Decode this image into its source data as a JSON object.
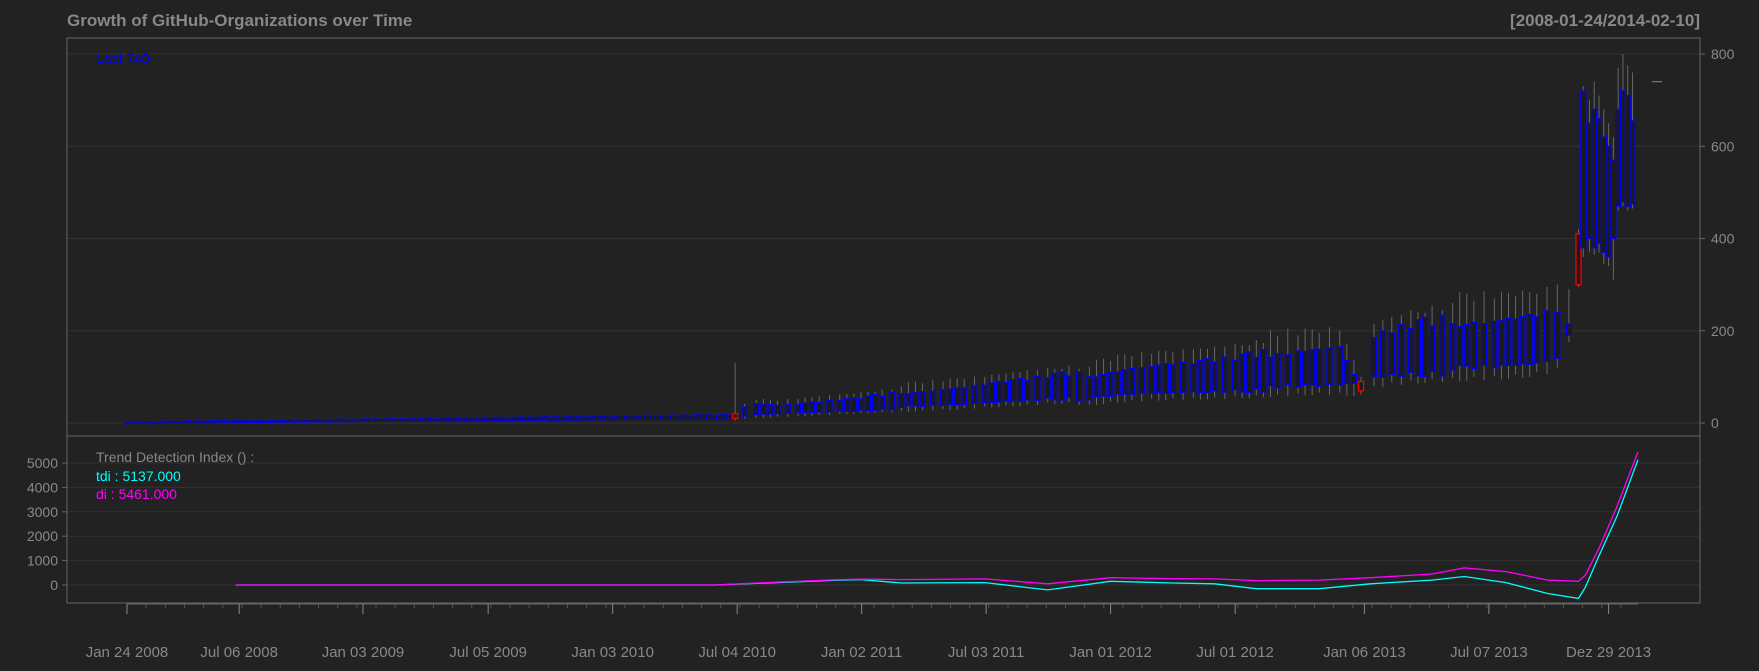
{
  "chart_data": {
    "type": "candlestick",
    "title": "Growth of GitHub-Organizations over Time",
    "date_range": "[2008-01-24/2014-02-10]",
    "last_label": "Last 740",
    "price_panel": {
      "yticks": [
        "800",
        "600",
        "400",
        "200",
        "0"
      ],
      "ylim": [
        0,
        800
      ],
      "grid": true,
      "candles": [
        {
          "x": "2010-07-01",
          "open": 10,
          "close": 20,
          "low": 5,
          "high": 130,
          "up": false
        },
        {
          "x": "2010-07-15",
          "open": 15,
          "close": 35,
          "low": 10,
          "high": 42,
          "up": true
        },
        {
          "x": "2010-08-01",
          "open": 18,
          "close": 42,
          "low": 12,
          "high": 50,
          "up": true
        },
        {
          "x": "2010-09-01",
          "open": 20,
          "close": 38,
          "low": 14,
          "high": 48,
          "up": true
        },
        {
          "x": "2010-10-01",
          "open": 22,
          "close": 40,
          "low": 15,
          "high": 52,
          "up": true
        },
        {
          "x": "2010-11-01",
          "open": 24,
          "close": 45,
          "low": 18,
          "high": 58,
          "up": true
        },
        {
          "x": "2010-12-01",
          "open": 26,
          "close": 48,
          "low": 20,
          "high": 62,
          "up": true
        },
        {
          "x": "2011-01-01",
          "open": 28,
          "close": 52,
          "low": 22,
          "high": 68,
          "up": true
        },
        {
          "x": "2011-02-01",
          "open": 30,
          "close": 58,
          "low": 24,
          "high": 72,
          "up": true
        },
        {
          "x": "2011-03-01",
          "open": 34,
          "close": 64,
          "low": 26,
          "high": 80,
          "up": true
        },
        {
          "x": "2011-04-01",
          "open": 36,
          "close": 68,
          "low": 28,
          "high": 86,
          "up": true
        },
        {
          "x": "2011-05-01",
          "open": 38,
          "close": 72,
          "low": 30,
          "high": 90,
          "up": true
        },
        {
          "x": "2011-06-01",
          "open": 40,
          "close": 76,
          "low": 32,
          "high": 95,
          "up": true
        },
        {
          "x": "2011-07-01",
          "open": 44,
          "close": 82,
          "low": 36,
          "high": 100,
          "up": true
        },
        {
          "x": "2011-08-01",
          "open": 48,
          "close": 88,
          "low": 38,
          "high": 108,
          "up": true
        },
        {
          "x": "2011-09-01",
          "open": 50,
          "close": 92,
          "low": 40,
          "high": 115,
          "up": true
        },
        {
          "x": "2011-10-01",
          "open": 54,
          "close": 98,
          "low": 44,
          "high": 120,
          "up": true
        },
        {
          "x": "2011-11-01",
          "open": 56,
          "close": 102,
          "low": 46,
          "high": 125,
          "up": true
        },
        {
          "x": "2011-12-01",
          "open": 50,
          "close": 100,
          "low": 40,
          "high": 122,
          "up": true
        },
        {
          "x": "2012-01-01",
          "open": 58,
          "close": 110,
          "low": 46,
          "high": 135,
          "up": true
        },
        {
          "x": "2012-02-01",
          "open": 62,
          "close": 118,
          "low": 50,
          "high": 145,
          "up": true
        },
        {
          "x": "2012-03-01",
          "open": 64,
          "close": 122,
          "low": 52,
          "high": 150,
          "up": true
        },
        {
          "x": "2012-04-01",
          "open": 66,
          "close": 126,
          "low": 54,
          "high": 155,
          "up": true
        },
        {
          "x": "2012-05-01",
          "open": 68,
          "close": 128,
          "low": 55,
          "high": 160,
          "up": true
        },
        {
          "x": "2012-06-01",
          "open": 70,
          "close": 132,
          "low": 56,
          "high": 165,
          "up": true
        },
        {
          "x": "2012-07-01",
          "open": 72,
          "close": 136,
          "low": 58,
          "high": 172,
          "up": true
        },
        {
          "x": "2012-08-01",
          "open": 74,
          "close": 142,
          "low": 60,
          "high": 180,
          "up": true
        },
        {
          "x": "2012-09-01",
          "open": 76,
          "close": 150,
          "low": 62,
          "high": 188,
          "up": true
        },
        {
          "x": "2012-10-01",
          "open": 78,
          "close": 156,
          "low": 64,
          "high": 190,
          "up": true
        },
        {
          "x": "2012-11-01",
          "open": 80,
          "close": 160,
          "low": 66,
          "high": 195,
          "up": true
        },
        {
          "x": "2012-12-01",
          "open": 82,
          "close": 165,
          "low": 66,
          "high": 200,
          "up": true
        },
        {
          "x": "2013-01-01",
          "open": 90,
          "close": 70,
          "low": 62,
          "high": 100,
          "up": false
        },
        {
          "x": "2013-01-20",
          "open": 100,
          "close": 185,
          "low": 80,
          "high": 215,
          "up": true
        },
        {
          "x": "2013-02-15",
          "open": 105,
          "close": 195,
          "low": 88,
          "high": 230,
          "up": true
        },
        {
          "x": "2013-03-15",
          "open": 110,
          "close": 205,
          "low": 92,
          "high": 245,
          "up": true
        },
        {
          "x": "2013-04-15",
          "open": 112,
          "close": 210,
          "low": 95,
          "high": 255,
          "up": true
        },
        {
          "x": "2013-05-15",
          "open": 115,
          "close": 215,
          "low": 98,
          "high": 260,
          "up": true
        },
        {
          "x": "2013-06-15",
          "open": 118,
          "close": 218,
          "low": 100,
          "high": 265,
          "up": true
        },
        {
          "x": "2013-07-15",
          "open": 120,
          "close": 220,
          "low": 102,
          "high": 270,
          "up": true
        },
        {
          "x": "2013-08-15",
          "open": 125,
          "close": 225,
          "low": 105,
          "high": 275,
          "up": true
        },
        {
          "x": "2013-09-15",
          "open": 130,
          "close": 230,
          "low": 110,
          "high": 280,
          "up": true
        },
        {
          "x": "2013-10-15",
          "open": 140,
          "close": 240,
          "low": 120,
          "high": 300,
          "up": true
        },
        {
          "x": "2013-11-01",
          "open": 190,
          "close": 215,
          "low": 175,
          "high": 290,
          "up": true
        },
        {
          "x": "2013-11-15",
          "open": 410,
          "close": 300,
          "low": 295,
          "high": 420,
          "up": false
        },
        {
          "x": "2013-11-22",
          "open": 380,
          "close": 720,
          "low": 360,
          "high": 730,
          "up": true
        },
        {
          "x": "2013-12-01",
          "open": 400,
          "close": 650,
          "low": 370,
          "high": 700,
          "up": true
        },
        {
          "x": "2013-12-08",
          "open": 380,
          "close": 680,
          "low": 365,
          "high": 740,
          "up": true
        },
        {
          "x": "2013-12-15",
          "open": 390,
          "close": 660,
          "low": 370,
          "high": 710,
          "up": true
        },
        {
          "x": "2013-12-22",
          "open": 370,
          "close": 620,
          "low": 345,
          "high": 680,
          "up": true
        },
        {
          "x": "2013-12-29",
          "open": 360,
          "close": 600,
          "low": 340,
          "high": 650,
          "up": true
        },
        {
          "x": "2014-01-05",
          "open": 400,
          "close": 570,
          "low": 310,
          "high": 620,
          "up": true
        },
        {
          "x": "2014-01-12",
          "open": 470,
          "close": 680,
          "low": 460,
          "high": 770,
          "up": true
        },
        {
          "x": "2014-01-19",
          "open": 480,
          "close": 720,
          "low": 470,
          "high": 800,
          "up": true
        },
        {
          "x": "2014-01-26",
          "open": 470,
          "close": 710,
          "low": 460,
          "high": 775,
          "up": true
        },
        {
          "x": "2014-02-02",
          "open": 475,
          "close": 655,
          "low": 465,
          "high": 760,
          "up": true
        }
      ],
      "early_start": "2008-01-24",
      "early_end": "2010-06-30",
      "last_value": 740
    },
    "tdi_panel": {
      "label": "Trend Detection Index () :",
      "yticks": [
        "5000",
        "4000",
        "3000",
        "2000",
        "1000",
        "0"
      ],
      "ylim": [
        -700,
        5500
      ],
      "series": [
        {
          "name": "tdi",
          "value_label": "tdi : 5137.000",
          "color": "#00ffff",
          "points": [
            [
              "2008-07-01",
              0
            ],
            [
              "2009-07-01",
              0
            ],
            [
              "2010-01-01",
              0
            ],
            [
              "2010-06-01",
              0
            ],
            [
              "2010-09-01",
              100
            ],
            [
              "2010-12-01",
              200
            ],
            [
              "2011-01-01",
              220
            ],
            [
              "2011-03-01",
              80
            ],
            [
              "2011-07-01",
              100
            ],
            [
              "2011-10-01",
              -200
            ],
            [
              "2012-01-01",
              150
            ],
            [
              "2012-04-01",
              80
            ],
            [
              "2012-06-01",
              50
            ],
            [
              "2012-08-01",
              -150
            ],
            [
              "2012-11-01",
              -150
            ],
            [
              "2013-01-15",
              50
            ],
            [
              "2013-04-15",
              200
            ],
            [
              "2013-06-01",
              350
            ],
            [
              "2013-08-01",
              100
            ],
            [
              "2013-10-01",
              -350
            ],
            [
              "2013-11-15",
              -550
            ],
            [
              "2013-11-25",
              -100
            ],
            [
              "2013-12-15",
              1200
            ],
            [
              "2014-01-10",
              2800
            ],
            [
              "2014-02-10",
              5137
            ]
          ]
        },
        {
          "name": "di",
          "value_label": "di : 5461.000",
          "color": "#ff00ff",
          "points": [
            [
              "2008-07-01",
              0
            ],
            [
              "2009-07-01",
              0
            ],
            [
              "2010-01-01",
              0
            ],
            [
              "2010-06-01",
              0
            ],
            [
              "2010-09-01",
              120
            ],
            [
              "2010-12-01",
              220
            ],
            [
              "2011-01-01",
              240
            ],
            [
              "2011-03-01",
              220
            ],
            [
              "2011-07-01",
              250
            ],
            [
              "2011-10-01",
              50
            ],
            [
              "2012-01-01",
              300
            ],
            [
              "2012-04-01",
              260
            ],
            [
              "2012-06-01",
              250
            ],
            [
              "2012-08-01",
              180
            ],
            [
              "2012-11-01",
              200
            ],
            [
              "2013-01-15",
              300
            ],
            [
              "2013-04-15",
              450
            ],
            [
              "2013-06-01",
              700
            ],
            [
              "2013-08-01",
              550
            ],
            [
              "2013-10-01",
              200
            ],
            [
              "2013-11-15",
              150
            ],
            [
              "2013-11-25",
              400
            ],
            [
              "2013-12-15",
              1500
            ],
            [
              "2014-01-10",
              3200
            ],
            [
              "2014-02-10",
              5461
            ]
          ]
        }
      ]
    },
    "x_tick_labels": [
      "Jan 24 2008",
      "Jul 06 2008",
      "Jan 03 2009",
      "Jul 05 2009",
      "Jan 03 2010",
      "Jul 04 2010",
      "Jan 02 2011",
      "Jul 03 2011",
      "Jan 01 2012",
      "Jul 01 2012",
      "Jan 06 2013",
      "Jul 07 2013",
      "Dez 29 2013"
    ],
    "x_tick_dates": [
      "2008-01-24",
      "2008-07-06",
      "2009-01-03",
      "2009-07-05",
      "2010-01-03",
      "2010-07-04",
      "2011-01-02",
      "2011-07-03",
      "2012-01-01",
      "2012-07-01",
      "2013-01-06",
      "2013-07-07",
      "2013-12-29"
    ],
    "colors": {
      "background": "#222222",
      "text": "#888888",
      "up": "#0000ff",
      "down": "#ff0000",
      "wick": "#666666",
      "last_label": "#0000ff"
    }
  }
}
